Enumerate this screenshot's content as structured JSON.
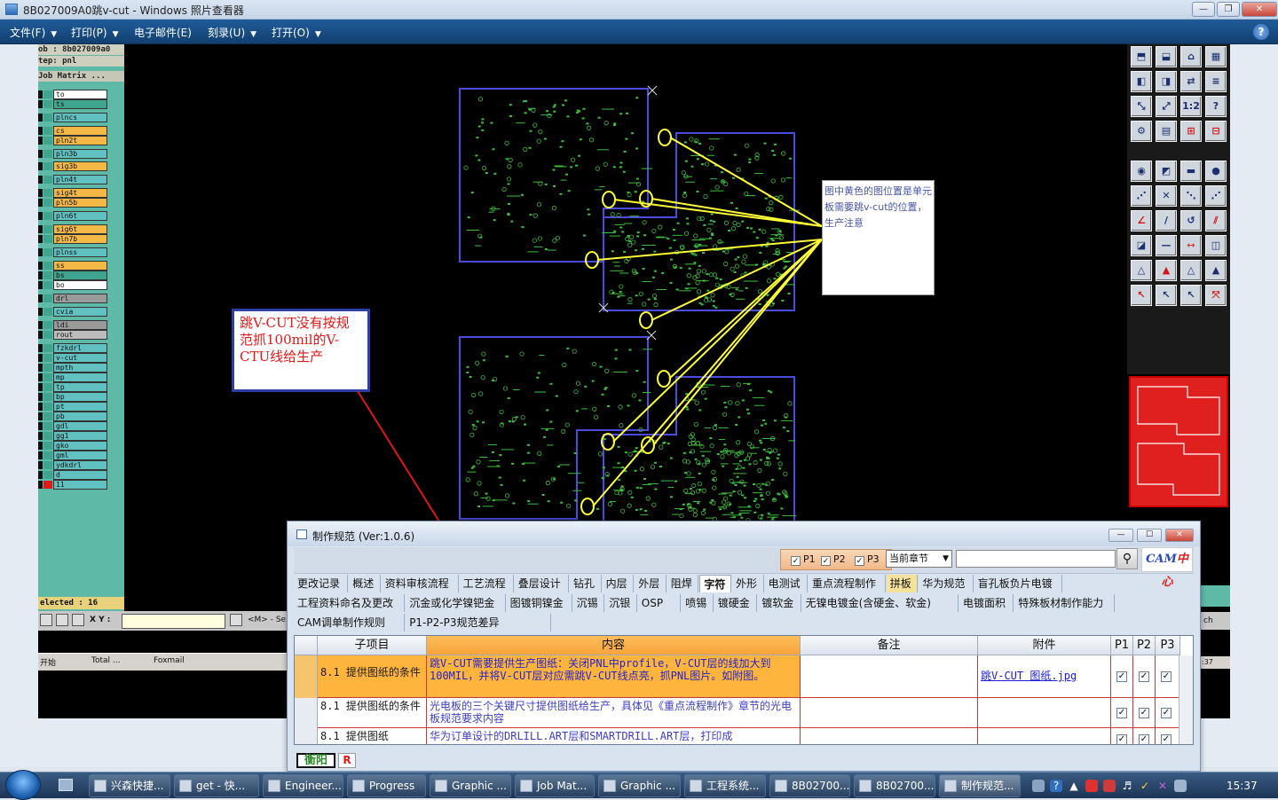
{
  "window": {
    "title": "8B027009A0跳v-cut - Windows 照片查看器",
    "controls": [
      "minimize",
      "maximize",
      "close"
    ]
  },
  "menu": [
    {
      "label": "文件(F)"
    },
    {
      "label": "打印(P)"
    },
    {
      "label": "电子邮件(E)"
    },
    {
      "label": "刻录(U)"
    },
    {
      "label": "打开(O)"
    }
  ],
  "cam": {
    "panel_header": {
      "job": "ob : 8b027009a0",
      "step": "tep: pnl",
      "matrix": "Job Matrix ..."
    },
    "layers": [
      {
        "name": "to",
        "fill": "#ffffff",
        "swatch": "#3fa58e"
      },
      {
        "name": "ts",
        "fill": "#3fa58e",
        "swatch": "#3fa58e"
      },
      {
        "name": "plncs",
        "fill": "#61c0c0",
        "swatch": "#3fa58e"
      },
      {
        "name": "cs",
        "fill": "#f4b847",
        "swatch": "#3fa58e"
      },
      {
        "name": "pln2t",
        "fill": "#f4b847",
        "swatch": "#3fa58e"
      },
      {
        "name": "pln3b",
        "fill": "#61c0c0",
        "swatch": "#3fa58e"
      },
      {
        "name": "sig3b",
        "fill": "#f4b847",
        "swatch": "#3fa58e"
      },
      {
        "name": "pln4t",
        "fill": "#61c0c0",
        "swatch": "#3fa58e"
      },
      {
        "name": "sig4t",
        "fill": "#f4b847",
        "swatch": "#3fa58e"
      },
      {
        "name": "pln5b",
        "fill": "#f4b847",
        "swatch": "#3fa58e"
      },
      {
        "name": "pln6t",
        "fill": "#61c0c0",
        "swatch": "#3fa58e"
      },
      {
        "name": "sig6t",
        "fill": "#f4b847",
        "swatch": "#3fa58e"
      },
      {
        "name": "pln7b",
        "fill": "#f4b847",
        "swatch": "#3fa58e"
      },
      {
        "name": "plnss",
        "fill": "#61c0c0",
        "swatch": "#3fa58e"
      },
      {
        "name": "ss",
        "fill": "#f4b847",
        "swatch": "#3fa58e"
      },
      {
        "name": "bs",
        "fill": "#3fa58e",
        "swatch": "#3fa58e"
      },
      {
        "name": "bo",
        "fill": "#ffffff",
        "swatch": "#3fa58e"
      },
      {
        "name": "drl",
        "fill": "#9a9a9a",
        "swatch": "#3fa58e"
      },
      {
        "name": "cvia",
        "fill": "#61c0c0",
        "swatch": "#3fa58e"
      },
      {
        "name": "ldi",
        "fill": "#9a9a9a",
        "swatch": "#3fa58e"
      },
      {
        "name": "rout",
        "fill": "#bdbdbd",
        "swatch": "#3fa58e"
      },
      {
        "name": "fzkdrl",
        "fill": "#61c0c0",
        "swatch": "#3fa58e"
      },
      {
        "name": "v-cut",
        "fill": "#61c0c0",
        "swatch": "#3fa58e"
      },
      {
        "name": "mpth",
        "fill": "#61c0c0",
        "swatch": "#3fa58e"
      },
      {
        "name": "mp",
        "fill": "#61c0c0",
        "swatch": "#3fa58e"
      },
      {
        "name": "tp",
        "fill": "#61c0c0",
        "swatch": "#3fa58e"
      },
      {
        "name": "bp",
        "fill": "#61c0c0",
        "swatch": "#3fa58e"
      },
      {
        "name": "pt",
        "fill": "#61c0c0",
        "swatch": "#3fa58e"
      },
      {
        "name": "pb",
        "fill": "#61c0c0",
        "swatch": "#3fa58e"
      },
      {
        "name": "gdl",
        "fill": "#61c0c0",
        "swatch": "#3fa58e"
      },
      {
        "name": "gg1",
        "fill": "#61c0c0",
        "swatch": "#3fa58e"
      },
      {
        "name": "gko",
        "fill": "#61c0c0",
        "swatch": "#3fa58e"
      },
      {
        "name": "gml",
        "fill": "#61c0c0",
        "swatch": "#3fa58e"
      },
      {
        "name": "ydkdrl",
        "fill": "#61c0c0",
        "swatch": "#3fa58e"
      },
      {
        "name": "d",
        "fill": "#61c0c0",
        "swatch": "#3fa58e"
      },
      {
        "name": "11",
        "fill": "#61c0c0",
        "swatch": "#e01818"
      }
    ],
    "selected_label": "elected : 16",
    "xy_label": "X Y :",
    "m_label": "<M> - Se",
    "inner_taskbar": [
      "开始",
      "Total ...",
      "Foxmail"
    ],
    "note_text": "图中黄色的图位置是单元板需要跳v-cut的位置，生产注意",
    "warning_text": "跳V-CUT没有按规范抓100mil的V-CTU线给生产",
    "right_side_labels": [
      "ch",
      ":37"
    ]
  },
  "dialog": {
    "title": "制作规范 (Ver:1.0.6)",
    "filters": [
      {
        "label": "P1",
        "checked": true
      },
      {
        "label": "P2",
        "checked": true
      },
      {
        "label": "P3",
        "checked": true
      }
    ],
    "chapter_select": "当前章节",
    "search_value": "",
    "logo": {
      "part1": "CAM",
      "part2": "中心"
    },
    "tabs_row1": [
      "更改记录",
      "概述",
      "资料审核流程",
      "工艺流程",
      "叠层设计",
      "钻孔",
      "内层",
      "外层",
      "阻焊",
      "字符",
      "外形",
      "电测试",
      "重点流程制作",
      "拼板",
      "华为规范",
      "盲孔板负片电镀"
    ],
    "tabs_row2": [
      "工程资料命名及更改",
      "沉金或化学镍钯金",
      "图镀铜镍金",
      "沉锡",
      "沉银",
      "OSP",
      "喷锡",
      "镀硬金",
      "镀软金",
      "无镍电镀金(含硬金、软金)",
      "电镀面积",
      "特殊板材制作能力"
    ],
    "tabs_row3": [
      "CAM调单制作规则",
      "P1-P2-P3规范差异"
    ],
    "active_tab": "字符",
    "highlight_tab": "拼板",
    "columns": [
      "子项目",
      "内容",
      "备注",
      "附件",
      "P1",
      "P2",
      "P3"
    ],
    "rows": [
      {
        "sub": "8.1 提供图纸的条件",
        "content": "跳V-CUT需要提供生产图纸：关闭PNL中profile，V-CUT层的线加大到100MIL，并将V-CUT层对应需跳V-CUT线点亮，抓PNL图片。如附图。",
        "note": "",
        "attachment": "跳V-CUT 图纸.jpg",
        "p1": true,
        "p2": true,
        "p3": true,
        "selected": true
      },
      {
        "sub": "8.1 提供图纸的条件",
        "content": "光电板的三个关键尺寸提供图纸给生产，具体见《重点流程制作》章节的光电板规范要求内容",
        "note": "",
        "attachment": "",
        "p1": true,
        "p2": true,
        "p3": true,
        "selected": false
      },
      {
        "sub": "8.1 提供图纸",
        "content": "华为订单设计的DRLILL.ART层和SMARTDRILL.ART层，打印成",
        "note": "",
        "attachment": "",
        "p1": true,
        "p2": true,
        "p3": true,
        "selected": false
      }
    ],
    "status_badge_1": "衡阳",
    "status_badge_2": "R"
  },
  "taskbar": {
    "items": [
      {
        "label": "兴森快捷..."
      },
      {
        "label": "get - 快..."
      },
      {
        "label": "Engineer..."
      },
      {
        "label": "Progress"
      },
      {
        "label": "Graphic ..."
      },
      {
        "label": "Job Mat..."
      },
      {
        "label": "Graphic ..."
      },
      {
        "label": "工程系统..."
      },
      {
        "label": "8B02700..."
      },
      {
        "label": "8B02700..."
      },
      {
        "label": "制作规范..."
      }
    ],
    "clock": "15:37"
  },
  "colors": {
    "board_bg": "#000000",
    "trace_green": "#3fbf3f",
    "board_outline": "#4b4be0",
    "annotation_yellow": "#ffff3a",
    "arrow_red": "#e01818",
    "preview_red": "#e01f1f"
  }
}
